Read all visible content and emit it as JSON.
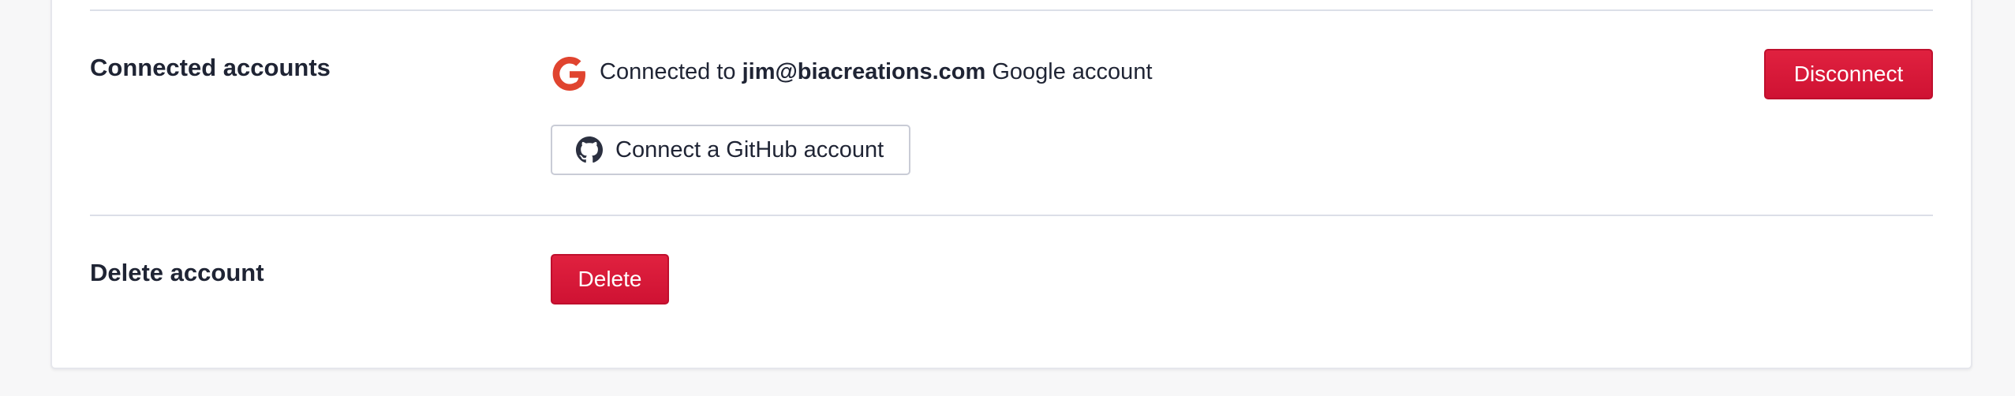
{
  "sections": {
    "connected_accounts": {
      "title": "Connected accounts",
      "google": {
        "prefix": "Connected to",
        "email": "jim@biacreations.com",
        "suffix": "Google account",
        "disconnect_label": "Disconnect",
        "icon": "google-g-icon"
      },
      "github": {
        "connect_label": "Connect a GitHub account",
        "icon": "github-icon"
      }
    },
    "delete_account": {
      "title": "Delete account",
      "delete_label": "Delete"
    }
  },
  "colors": {
    "danger": "#d7173a",
    "text": "#1f2434",
    "divider": "#dcdfe8",
    "google_red": "#e0442f"
  }
}
